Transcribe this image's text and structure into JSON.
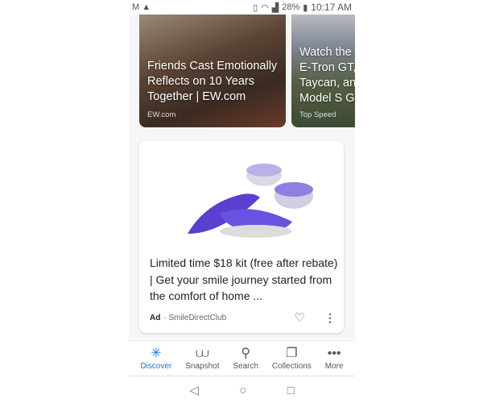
{
  "status_bar": {
    "battery": "28%",
    "time": "10:17 AM"
  },
  "stories": [
    {
      "title_lines": [
        "Friends Cast Emotionally",
        "Reflects on 10 Years",
        "Together | EW.com"
      ],
      "source": "EW.com"
    },
    {
      "title_lines": [
        "Watch the",
        "E-Tron GT,",
        "Taycan, and",
        "Model S Go"
      ],
      "source": "Top Speed"
    }
  ],
  "ad": {
    "title": "Limited time $18 kit (free after rebate) | Get your smile journey started from the comfort of home ...",
    "badge": "Ad",
    "advertiser": "SmileDirectClub",
    "accent": "#5a3fd0"
  },
  "bottom_nav": [
    {
      "label": "Discover",
      "icon": "asterisk-icon",
      "active": true
    },
    {
      "label": "Snapshot",
      "icon": "snapshot-icon"
    },
    {
      "label": "Search",
      "icon": "search-icon"
    },
    {
      "label": "Collections",
      "icon": "collections-icon"
    },
    {
      "label": "More",
      "icon": "more-icon"
    }
  ],
  "accent": "#1a73e8"
}
